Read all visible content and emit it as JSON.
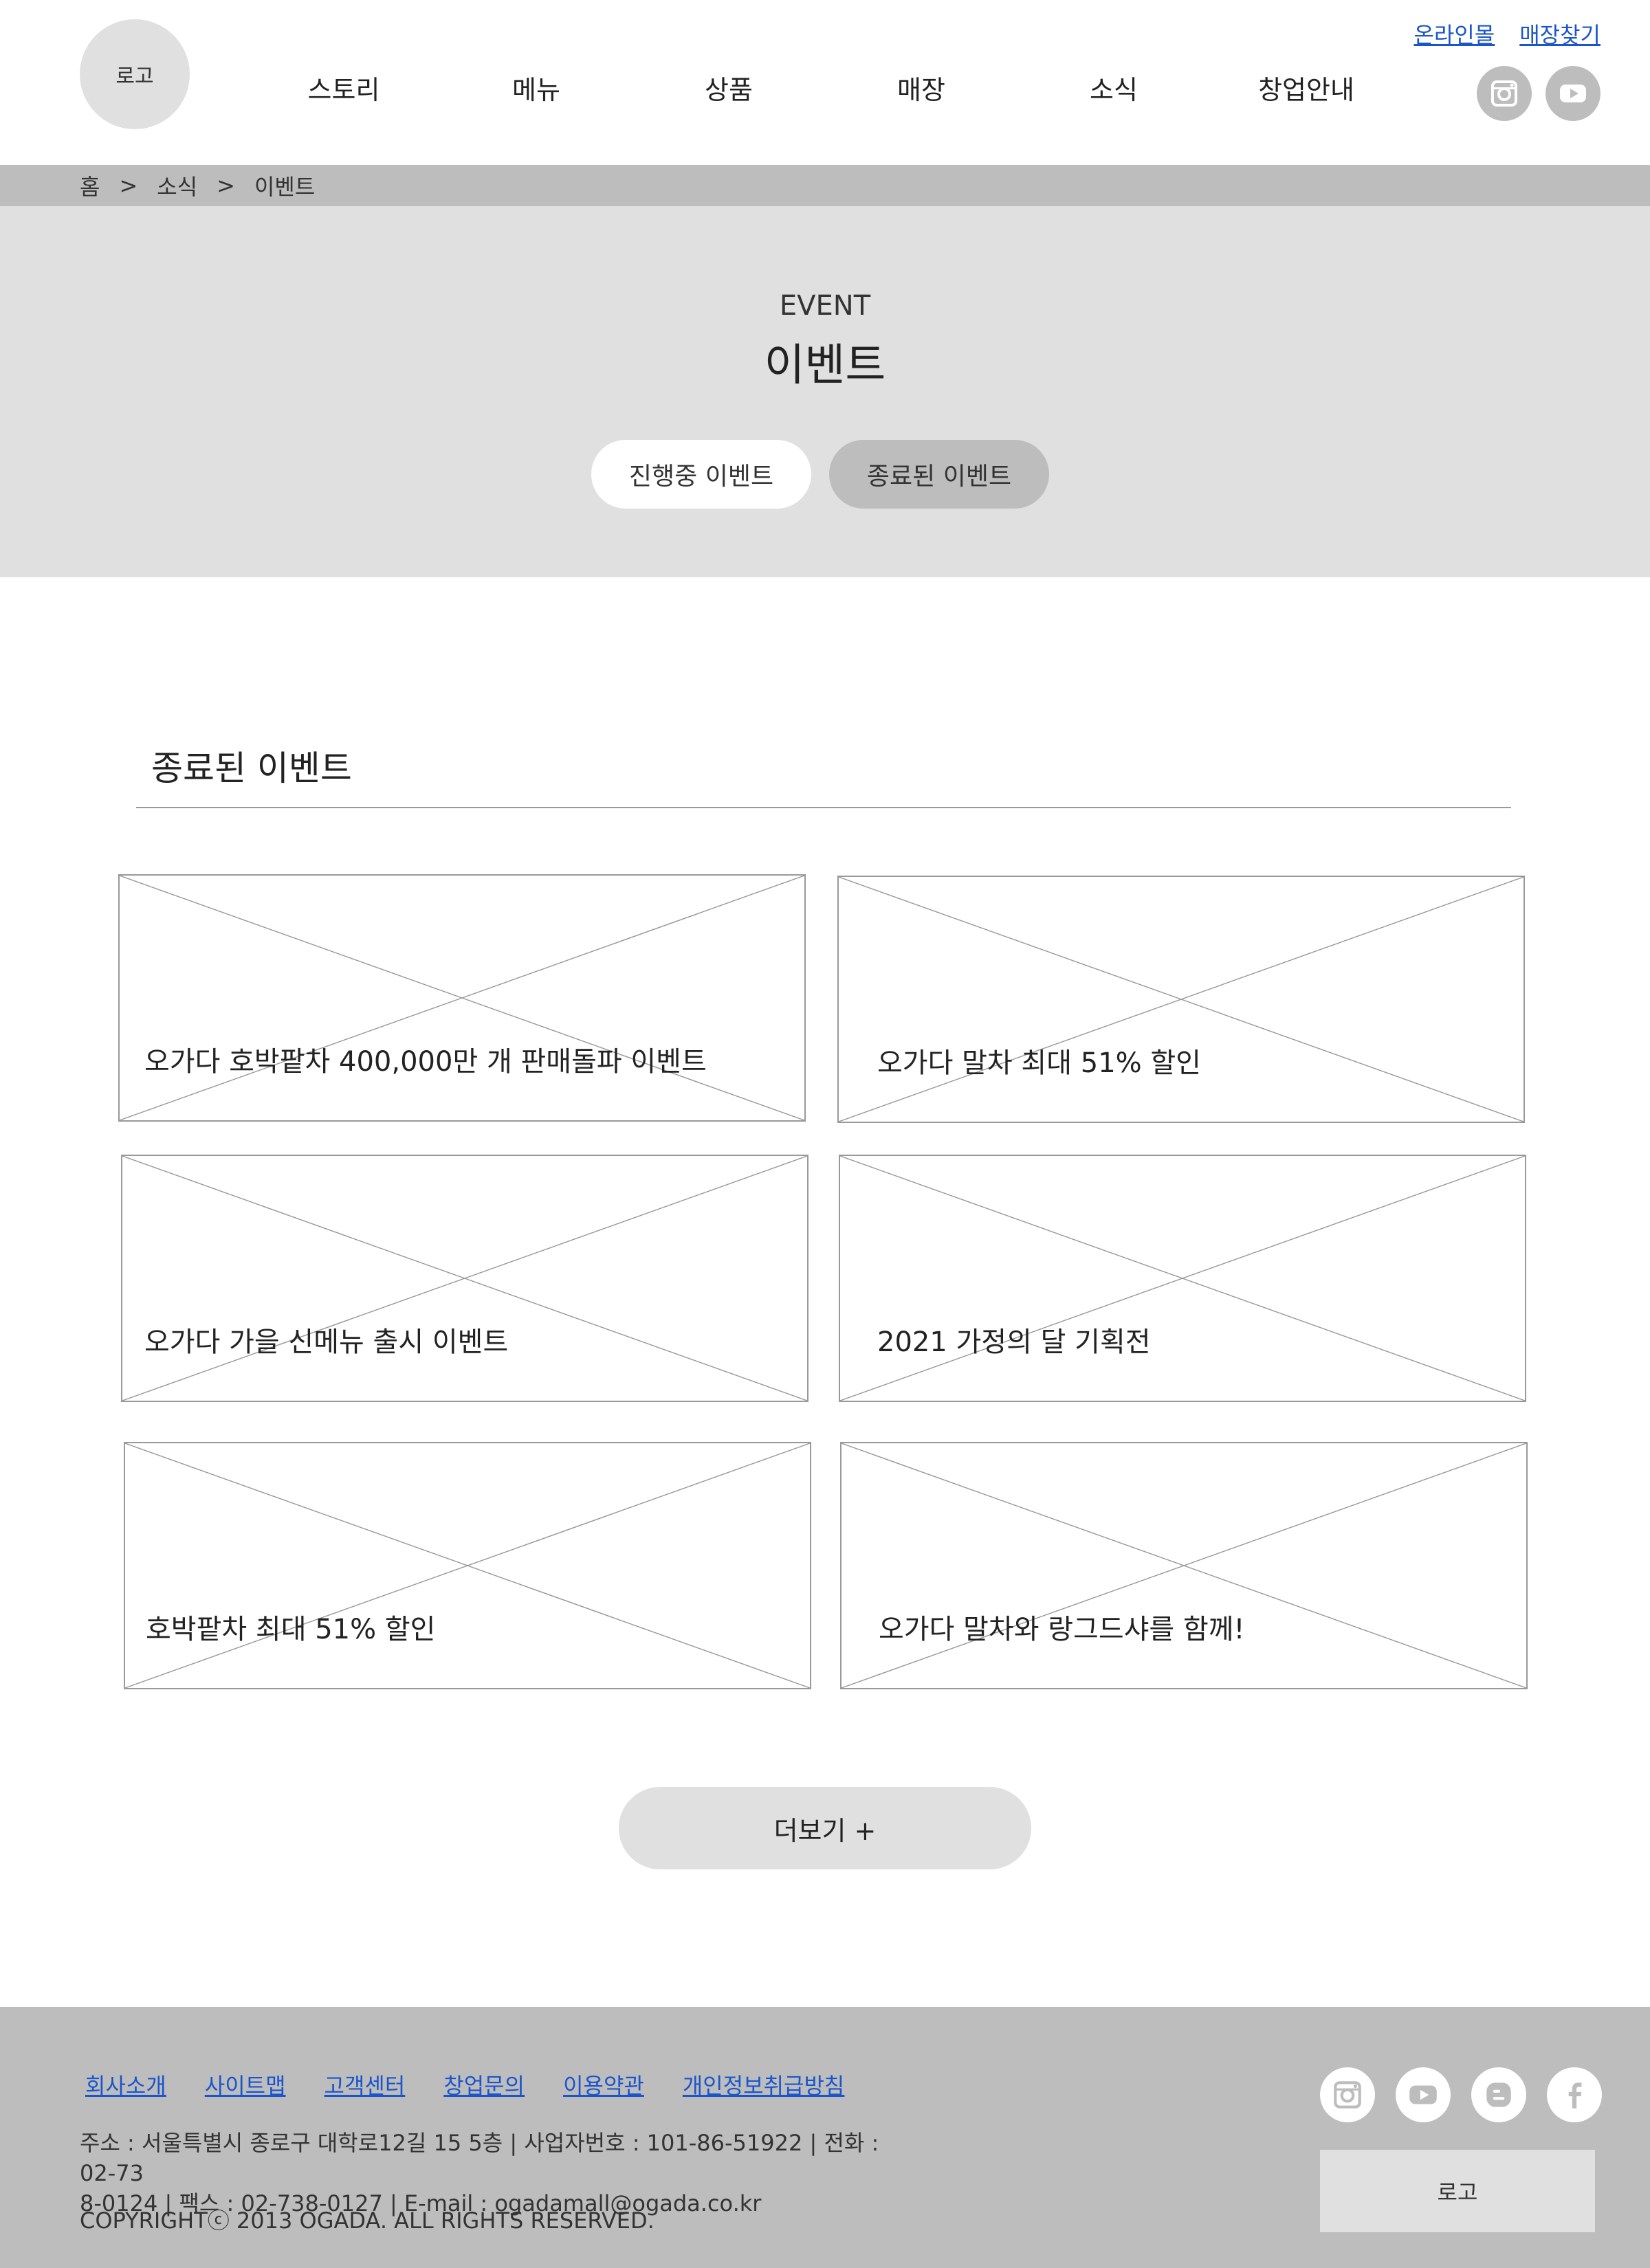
{
  "header": {
    "logo_text": "로고",
    "top_links": [
      {
        "label": "온라인몰"
      },
      {
        "label": "매장찾기"
      }
    ],
    "nav": [
      {
        "label": "스토리"
      },
      {
        "label": "메뉴"
      },
      {
        "label": "상품"
      },
      {
        "label": "매장"
      },
      {
        "label": "소식"
      },
      {
        "label": "창업안내"
      }
    ],
    "social_icons": [
      "instagram-icon",
      "youtube-icon"
    ]
  },
  "breadcrumb": {
    "items": [
      "홈",
      "소식",
      "이벤트"
    ],
    "separator": ">"
  },
  "hero": {
    "title_en": "EVENT",
    "title_ko": "이벤트",
    "tabs": [
      {
        "label": "진행중 이벤트",
        "active": false
      },
      {
        "label": "종료된 이벤트",
        "active": true
      }
    ]
  },
  "section": {
    "title": "종료된 이벤트",
    "cards": [
      {
        "title": "오가다 호박팥차 400,000만 개 판매돌파 이벤트"
      },
      {
        "title": "오가다 말차 최대 51% 할인"
      },
      {
        "title": "오가다 가을 신메뉴 출시 이벤트"
      },
      {
        "title": "2021 가정의 달 기획전"
      },
      {
        "title": "호박팥차 최대 51% 할인"
      },
      {
        "title": "오가다 말차와 랑그드샤를 함께!"
      }
    ],
    "more_label": "더보기 +"
  },
  "footer": {
    "links": [
      {
        "label": "회사소개"
      },
      {
        "label": "사이트맵"
      },
      {
        "label": "고객센터"
      },
      {
        "label": "창업문의"
      },
      {
        "label": "이용약관"
      },
      {
        "label": "개인정보취급방침"
      }
    ],
    "info_line1": "주소 : 서울특별시 종로구 대학로12길 15 5층 | 사업자번호 : 101-86-51922 | 전화 : 02-73",
    "info_line2": "8-0124 | 팩스 : 02-738-0127 | E-mail : ogadamall@ogada.co.kr",
    "copyright": "COPYRIGHTⓒ 2013 OGADA. ALL RIGHTS RESERVED.",
    "social_icons": [
      "instagram-icon",
      "youtube-icon",
      "blogger-icon",
      "facebook-icon"
    ],
    "logo_text": "로고"
  },
  "colors": {
    "gray_light": "#e0e0e0",
    "gray_mid": "#bdbdbd",
    "link_blue": "#1a55cc"
  }
}
